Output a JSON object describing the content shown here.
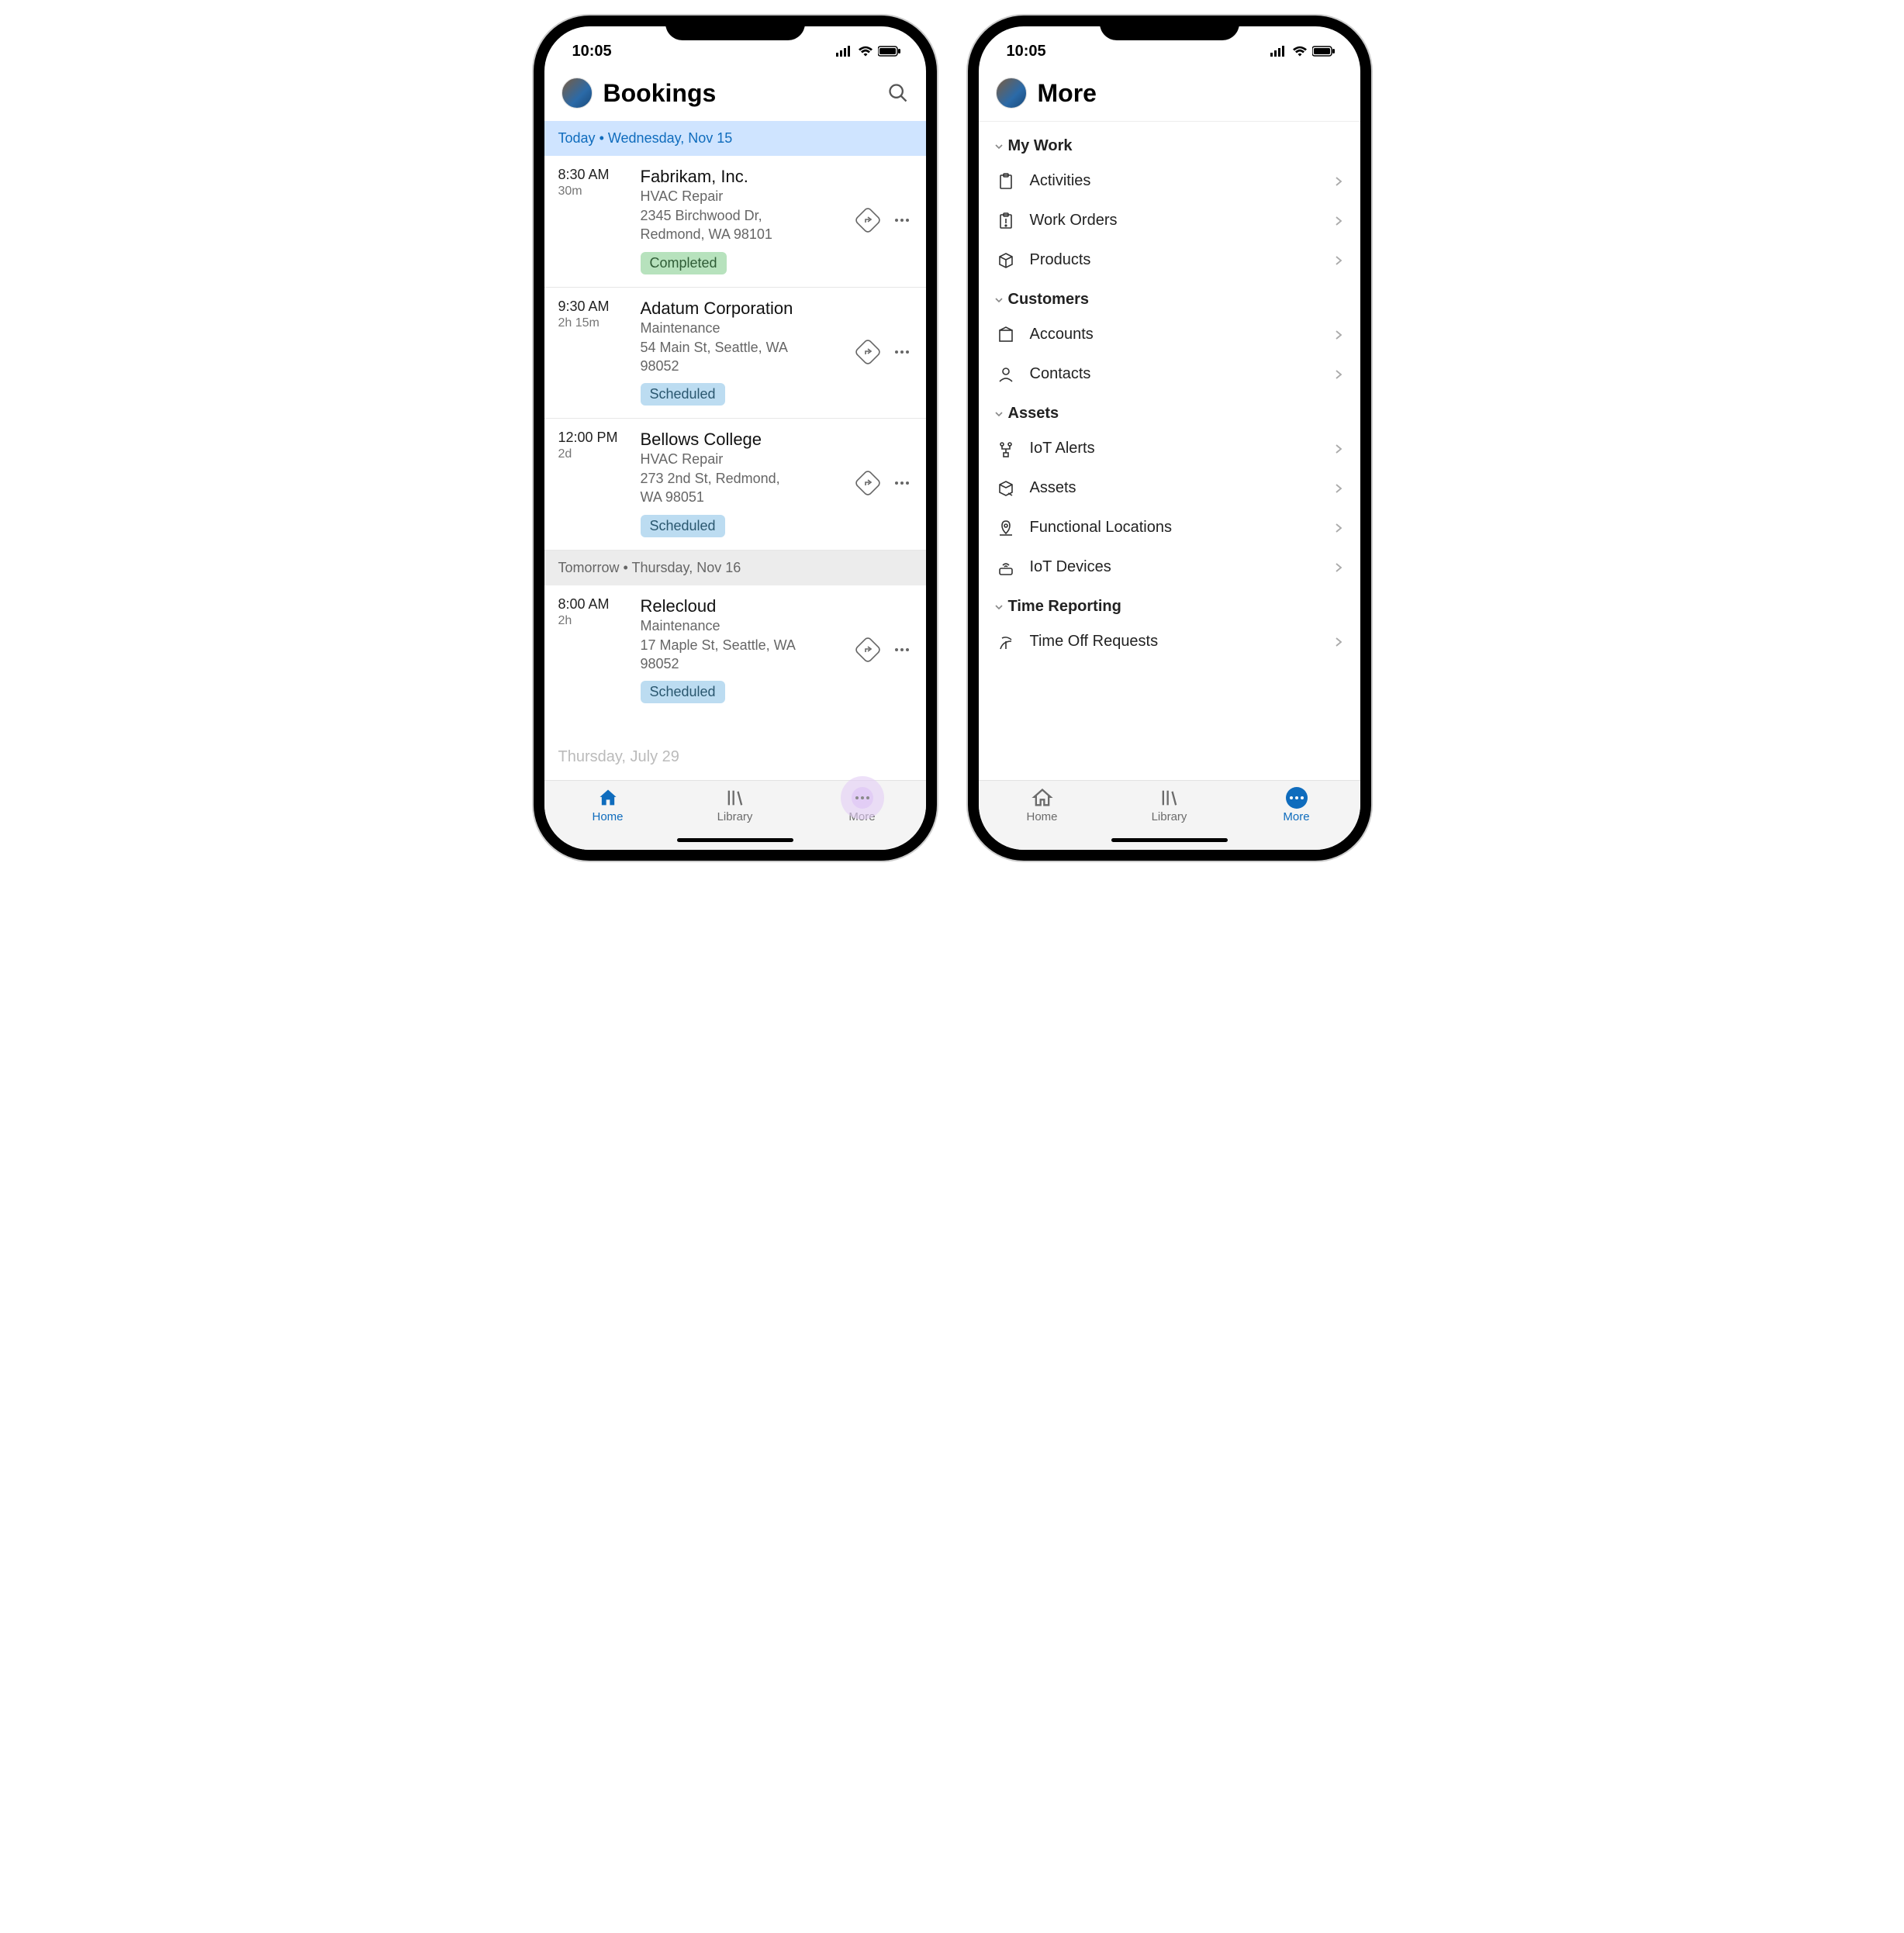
{
  "statusbar": {
    "time": "10:05"
  },
  "left": {
    "title": "Bookings",
    "sections": [
      {
        "kind": "today",
        "prefix": "Today",
        "date": "Wednesday, Nov 15",
        "items": [
          {
            "start": "8:30 AM",
            "duration": "30m",
            "customer": "Fabrikam, Inc.",
            "type": "HVAC Repair",
            "addr1": "2345 Birchwood Dr,",
            "addr2": "Redmond, WA 98101",
            "status": "Completed",
            "status_kind": "completed"
          },
          {
            "start": "9:30 AM",
            "duration": "2h 15m",
            "customer": "Adatum Corporation",
            "type": "Maintenance",
            "addr1": "54 Main St, Seattle, WA",
            "addr2": "98052",
            "status": "Scheduled",
            "status_kind": "scheduled"
          },
          {
            "start": "12:00 PM",
            "duration": "2d",
            "customer": "Bellows College",
            "type": "HVAC Repair",
            "addr1": "273 2nd St, Redmond,",
            "addr2": "WA 98051",
            "status": "Scheduled",
            "status_kind": "scheduled"
          }
        ]
      },
      {
        "kind": "tomorrow",
        "prefix": "Tomorrow",
        "date": "Thursday, Nov 16",
        "items": [
          {
            "start": "8:00 AM",
            "duration": "2h",
            "customer": "Relecloud",
            "type": "Maintenance",
            "addr1": "17 Maple St, Seattle, WA",
            "addr2": "98052",
            "status": "Scheduled",
            "status_kind": "scheduled"
          }
        ]
      }
    ],
    "faded_section": "Thursday, July 29",
    "tabs": {
      "home": "Home",
      "library": "Library",
      "more": "More",
      "active": "home"
    }
  },
  "right": {
    "title": "More",
    "groups": [
      {
        "title": "My Work",
        "items": [
          {
            "icon": "clipboard",
            "label": "Activities"
          },
          {
            "icon": "clipboard-ex",
            "label": "Work Orders"
          },
          {
            "icon": "box",
            "label": "Products"
          }
        ]
      },
      {
        "title": "Customers",
        "items": [
          {
            "icon": "account",
            "label": "Accounts"
          },
          {
            "icon": "person",
            "label": "Contacts"
          }
        ]
      },
      {
        "title": "Assets",
        "items": [
          {
            "icon": "iot-alert",
            "label": "IoT Alerts"
          },
          {
            "icon": "asset-box",
            "label": "Assets"
          },
          {
            "icon": "location-pin",
            "label": "Functional Locations"
          },
          {
            "icon": "iot-device",
            "label": "IoT Devices"
          }
        ]
      },
      {
        "title": "Time Reporting",
        "items": [
          {
            "icon": "time-off",
            "label": "Time Off Requests"
          }
        ]
      }
    ],
    "tabs": {
      "home": "Home",
      "library": "Library",
      "more": "More",
      "active": "more"
    }
  }
}
